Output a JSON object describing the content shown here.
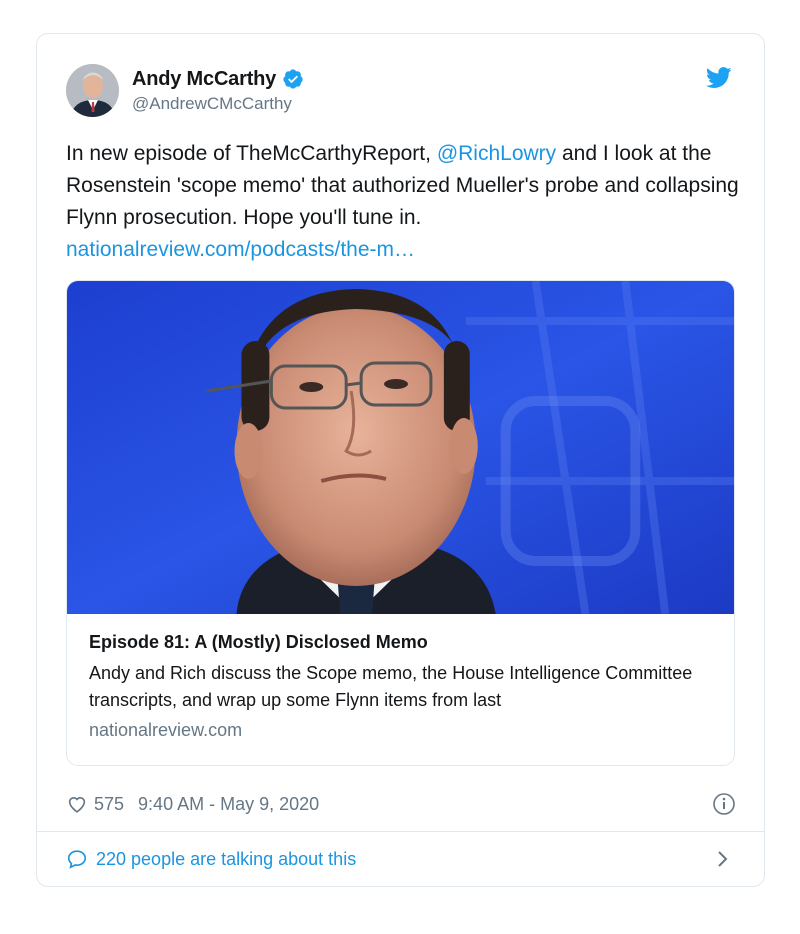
{
  "author": {
    "name": "Andy McCarthy",
    "handle": "@AndrewCMcCarthy",
    "verified_icon": "verified-badge-icon",
    "avatar_icon": "avatar-portrait"
  },
  "tweet": {
    "text_before": "In new episode of TheMcCarthyReport, ",
    "mention": "@RichLowry",
    "text_after": " and I look at the Rosenstein 'scope memo' that authorized Mueller's probe and collapsing Flynn prosecution. Hope you'll tune in.",
    "link": "nationalreview.com/podcasts/the-m…"
  },
  "card": {
    "title": "Episode 81: A (Mostly) Disclosed Memo",
    "description": "Andy and Rich discuss the Scope memo, the House Intelligence Committee transcripts, and wrap up some Flynn items from last",
    "domain": "nationalreview.com"
  },
  "meta": {
    "likes": "575",
    "timestamp": "9:40 AM - May 9, 2020"
  },
  "footer": {
    "talking": "220 people are talking about this"
  },
  "colors": {
    "accent": "#1b95e0",
    "muted": "#657786",
    "border": "#e1e8ed",
    "twitter_blue": "#1da1f2"
  }
}
